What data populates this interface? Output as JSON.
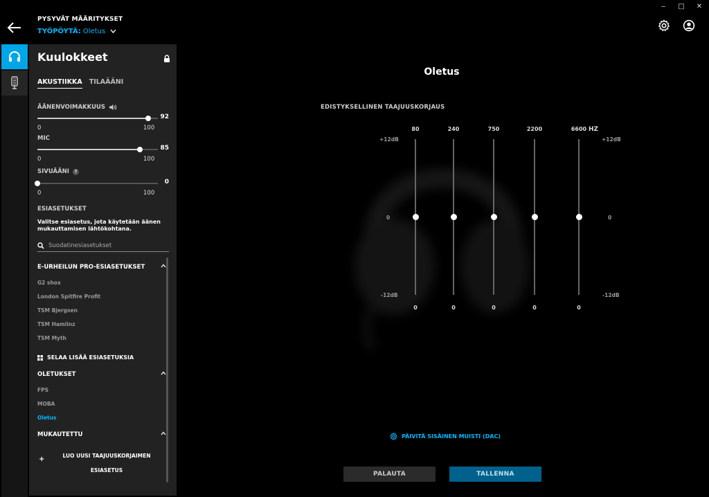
{
  "header": {
    "persistent_label": "PYSYVÄT MÄÄRITYKSET",
    "profile_prefix": "TYÖPÖYTÄ:",
    "profile_name": "Oletus"
  },
  "window_controls": [
    "‒",
    "□",
    "✕"
  ],
  "panel": {
    "title": "Kuulokkeet",
    "tabs": [
      {
        "label": "AKUSTIIKKA",
        "active": true
      },
      {
        "label": "TILAÄÄNI",
        "active": false
      }
    ],
    "volume": {
      "label": "ÄÄNENVOIMAKKUUS",
      "value": 92,
      "min": "0",
      "max": "100"
    },
    "mic": {
      "label": "MIC",
      "value": 85,
      "min": "0",
      "max": "100"
    },
    "sidetone": {
      "label": "SIVUÄÄNI",
      "help": "?",
      "value": 0,
      "min": "0",
      "max": "100"
    },
    "presets_heading": "ESIASETUKSET",
    "presets_description": "Valitse esiasetus, jota käytetään äänen mukauttamisen lähtökohtana.",
    "search_placeholder": "Suodatinesiasetukset",
    "groups": {
      "esports": {
        "label": "E-URHEILUN PRO-ESIASETUKSET",
        "items": [
          "G2 shox",
          "London Spitfire Profit",
          "TSM Bjergsen",
          "TSM Hamlinz",
          "TSM Myth"
        ]
      },
      "browse_label": "SELAA LISÄÄ ESIASETUKSIA",
      "defaults": {
        "label": "OLETUKSET",
        "items": [
          "FPS",
          "MOBA",
          "Oletus"
        ],
        "selected": "Oletus"
      },
      "custom": {
        "label": "MUKAUTETTU",
        "create_line1": "LUO UUSI TAAJUUSKORJAIMEN",
        "create_line2": "ESIASETUS"
      }
    }
  },
  "main": {
    "title": "Oletus",
    "eq_title": "EDISTYKSELLINEN TAAJUUSKORJAUS",
    "hz_label": "HZ",
    "db_top": "+12dB",
    "db_mid": "0",
    "db_bottom": "-12dB",
    "bands": [
      {
        "freq": "80",
        "gain": 0
      },
      {
        "freq": "240",
        "gain": 0
      },
      {
        "freq": "750",
        "gain": 0
      },
      {
        "freq": "2200",
        "gain": 0
      },
      {
        "freq": "6600",
        "gain": 0
      }
    ],
    "dac_label": "PÄIVITÄ SISÄINEN MUISTI (DAC)",
    "reset_label": "PALAUTA",
    "save_label": "TALLENNA"
  },
  "colors": {
    "accent": "#00b8fc",
    "rail_active": "#00a6e8",
    "panel_bg": "#222222",
    "save_bg": "#00618c"
  }
}
